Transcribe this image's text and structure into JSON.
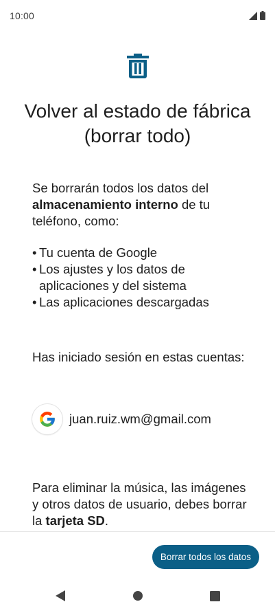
{
  "status_bar": {
    "time": "10:00",
    "icons": [
      "signal-icon",
      "battery-icon"
    ]
  },
  "header": {
    "icon": "trash-icon",
    "title": "Volver al estado de fábrica (borrar todo)"
  },
  "body": {
    "intro_prefix": "Se borrarán todos los datos del ",
    "intro_bold": "almacenamiento interno",
    "intro_suffix": " de tu teléfono, como:",
    "bullet_char": "•",
    "bullets": [
      "Tu cuenta de Google",
      "Los ajustes y los datos de aplicaciones y del sistema",
      "Las aplicaciones descargadas"
    ],
    "accounts_label": "Has iniciado sesión en estas cuentas:",
    "account": {
      "icon": "google-icon",
      "email": "juan.ruiz.wm@gmail.com"
    },
    "sd_prefix": "Para eliminar la música, las imágenes y otros datos de usuario, debes borrar la ",
    "sd_bold": "tarjeta SD",
    "sd_suffix": "."
  },
  "footer": {
    "erase_button_label": "Borrar todos los datos"
  },
  "nav_bar": {
    "buttons": [
      "back-icon",
      "home-icon",
      "recents-icon"
    ]
  },
  "colors": {
    "accent": "#0b5f87",
    "text": "#1f1f1f",
    "nav": "#444444"
  }
}
